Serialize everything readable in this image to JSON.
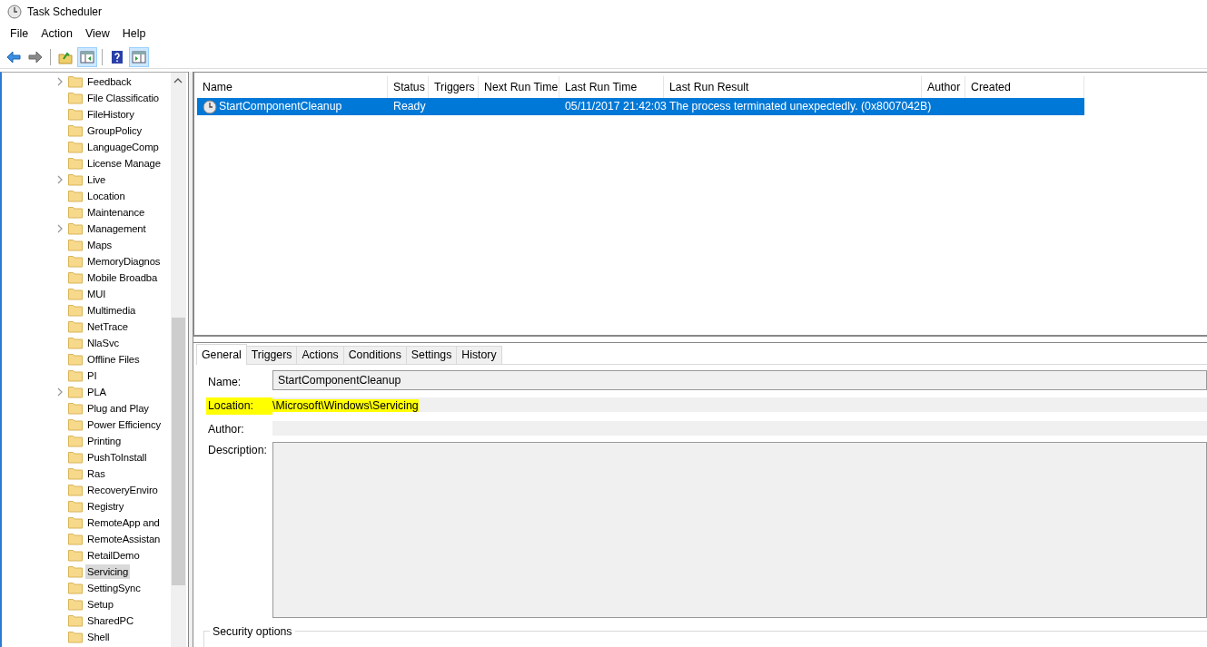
{
  "window": {
    "title": "Task Scheduler"
  },
  "menu": [
    "File",
    "Action",
    "View",
    "Help"
  ],
  "toolbar": [
    {
      "kind": "back",
      "pressed": false
    },
    {
      "kind": "forward",
      "pressed": false
    },
    {
      "kind": "sep"
    },
    {
      "kind": "up",
      "pressed": false
    },
    {
      "kind": "tree",
      "pressed": true
    },
    {
      "kind": "sep"
    },
    {
      "kind": "help",
      "pressed": false
    },
    {
      "kind": "pane",
      "pressed": true
    }
  ],
  "tree": {
    "items": [
      {
        "label": "Feedback",
        "expandable": true,
        "selected": false
      },
      {
        "label": "File Classificatio",
        "expandable": false,
        "selected": false
      },
      {
        "label": "FileHistory",
        "expandable": false,
        "selected": false
      },
      {
        "label": "GroupPolicy",
        "expandable": false,
        "selected": false
      },
      {
        "label": "LanguageComp",
        "expandable": false,
        "selected": false
      },
      {
        "label": "License Manage",
        "expandable": false,
        "selected": false
      },
      {
        "label": "Live",
        "expandable": true,
        "selected": false
      },
      {
        "label": "Location",
        "expandable": false,
        "selected": false
      },
      {
        "label": "Maintenance",
        "expandable": false,
        "selected": false
      },
      {
        "label": "Management",
        "expandable": true,
        "selected": false
      },
      {
        "label": "Maps",
        "expandable": false,
        "selected": false
      },
      {
        "label": "MemoryDiagnos",
        "expandable": false,
        "selected": false
      },
      {
        "label": "Mobile Broadba",
        "expandable": false,
        "selected": false
      },
      {
        "label": "MUI",
        "expandable": false,
        "selected": false
      },
      {
        "label": "Multimedia",
        "expandable": false,
        "selected": false
      },
      {
        "label": "NetTrace",
        "expandable": false,
        "selected": false
      },
      {
        "label": "NlaSvc",
        "expandable": false,
        "selected": false
      },
      {
        "label": "Offline Files",
        "expandable": false,
        "selected": false
      },
      {
        "label": "PI",
        "expandable": false,
        "selected": false
      },
      {
        "label": "PLA",
        "expandable": true,
        "selected": false
      },
      {
        "label": "Plug and Play",
        "expandable": false,
        "selected": false
      },
      {
        "label": "Power Efficiency",
        "expandable": false,
        "selected": false
      },
      {
        "label": "Printing",
        "expandable": false,
        "selected": false
      },
      {
        "label": "PushToInstall",
        "expandable": false,
        "selected": false
      },
      {
        "label": "Ras",
        "expandable": false,
        "selected": false
      },
      {
        "label": "RecoveryEnviro",
        "expandable": false,
        "selected": false
      },
      {
        "label": "Registry",
        "expandable": false,
        "selected": false
      },
      {
        "label": "RemoteApp and",
        "expandable": false,
        "selected": false
      },
      {
        "label": "RemoteAssistan",
        "expandable": false,
        "selected": false
      },
      {
        "label": "RetailDemo",
        "expandable": false,
        "selected": false
      },
      {
        "label": "Servicing",
        "expandable": false,
        "selected": true
      },
      {
        "label": "SettingSync",
        "expandable": false,
        "selected": false
      },
      {
        "label": "Setup",
        "expandable": false,
        "selected": false
      },
      {
        "label": "SharedPC",
        "expandable": false,
        "selected": false
      },
      {
        "label": "Shell",
        "expandable": false,
        "selected": false
      }
    ]
  },
  "task_table": {
    "columns": [
      "Name",
      "Status",
      "Triggers",
      "Next Run Time",
      "Last Run Time",
      "Last Run Result",
      "Author",
      "Created"
    ],
    "rows": [
      {
        "selected": true,
        "cells": [
          "StartComponentCleanup",
          "Ready",
          "",
          "",
          "05/11/2017 21:42:03",
          "The process terminated unexpectedly. (0x8007042B)",
          "",
          ""
        ]
      }
    ]
  },
  "details": {
    "tabs": [
      {
        "label": "General",
        "selected": true
      },
      {
        "label": "Triggers",
        "selected": false
      },
      {
        "label": "Actions",
        "selected": false
      },
      {
        "label": "Conditions",
        "selected": false
      },
      {
        "label": "Settings",
        "selected": false
      },
      {
        "label": "History",
        "selected": false
      }
    ],
    "fields": [
      {
        "kind": "input",
        "label": "Name:",
        "value": "StartComponentCleanup",
        "highlighted": false
      },
      {
        "kind": "readonly",
        "label": "Location:",
        "value": "\\Microsoft\\Windows\\Servicing",
        "highlighted": true
      },
      {
        "kind": "readonly",
        "label": "Author:",
        "highlighted": false
      },
      {
        "kind": "textarea",
        "label": "Description:",
        "highlighted": false
      }
    ],
    "group_label": "Security options"
  }
}
